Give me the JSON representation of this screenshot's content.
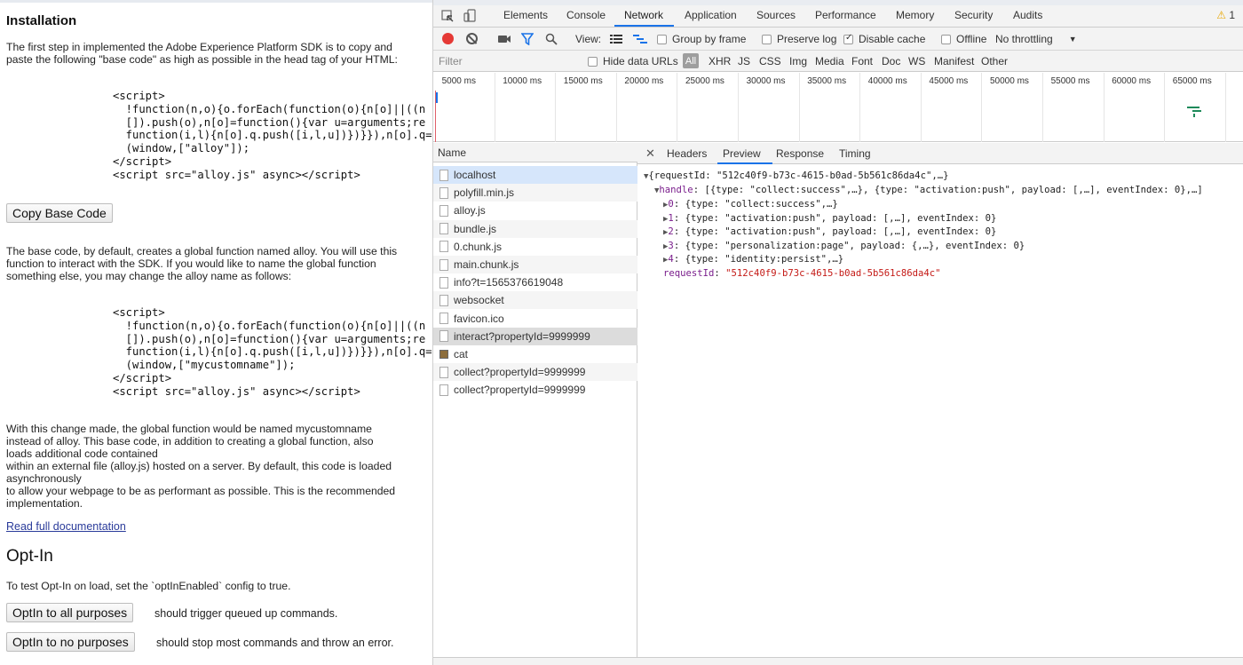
{
  "page": {
    "installation_heading": "Installation",
    "intro_lines": [
      "The first step in implemented the Adobe Experience Platform SDK is to copy and",
      "paste the following \"base code\" as high as possible in the head tag of your HTML:"
    ],
    "code_block_1": "<script>\n  !function(n,o){o.forEach(function(o){n[o]||((n\n  []).push(o),n[o]=function(){var u=arguments;re\n  function(i,l){n[o].q.push([i,l,u])})}}),n[o].q=[\n  (window,[\"alloy\"]);\n</script>\n<script src=\"alloy.js\" async></script>",
    "copy_button": "Copy Base Code",
    "rename_lines": [
      "The base code, by default, creates a global function named alloy. You will use this",
      "function to interact with the SDK. If you would like to name the global function",
      "something else, you may change the alloy name as follows:"
    ],
    "code_block_2": "<script>\n  !function(n,o){o.forEach(function(o){n[o]||((n\n  []).push(o),n[o]=function(){var u=arguments;re\n  function(i,l){n[o].q.push([i,l,u])})}}),n[o].q=[\n  (window,[\"mycustomname\"]);\n</script>\n<script src=\"alloy.js\" async></script>",
    "change_lines": [
      "With this change made, the global function would be named mycustomname",
      "instead of alloy. This base code, in addition to creating a global function, also",
      "loads additional code contained",
      "within an external file (alloy.js) hosted on a server. By default, this code is loaded",
      "asynchronously",
      "to allow your webpage to be as performant as possible. This is the recommended",
      "implementation."
    ],
    "doc_link": "Read full documentation",
    "optin_heading": "Opt-In",
    "optin_text": "To test Opt-In on load, set the `optInEnabled` config to true.",
    "optin_all_button": "OptIn to all purposes",
    "optin_all_note": "should trigger queued up commands.",
    "optin_none_button": "OptIn to no purposes",
    "optin_none_note": "should stop most commands and throw an error."
  },
  "devtools": {
    "tabs": [
      "Elements",
      "Console",
      "Network",
      "Application",
      "Sources",
      "Performance",
      "Memory",
      "Security",
      "Audits"
    ],
    "active_tab": "Network",
    "warning_count": "1",
    "toolbar": {
      "view_label": "View:",
      "group_by_frame": "Group by frame",
      "preserve_log": "Preserve log",
      "disable_cache": "Disable cache",
      "offline": "Offline",
      "throttling": "No throttling"
    },
    "filter": {
      "placeholder": "Filter",
      "hide_data_urls": "Hide data URLs",
      "all": "All",
      "types": [
        "XHR",
        "JS",
        "CSS",
        "Img",
        "Media",
        "Font",
        "Doc",
        "WS",
        "Manifest",
        "Other"
      ]
    },
    "timeline_labels": [
      "5000 ms",
      "10000 ms",
      "15000 ms",
      "20000 ms",
      "25000 ms",
      "30000 ms",
      "35000 ms",
      "40000 ms",
      "45000 ms",
      "50000 ms",
      "55000 ms",
      "60000 ms",
      "65000 ms"
    ],
    "name_header": "Name",
    "requests": [
      {
        "name": "localhost",
        "state": "selected"
      },
      {
        "name": "polyfill.min.js",
        "state": ""
      },
      {
        "name": "alloy.js",
        "state": ""
      },
      {
        "name": "bundle.js",
        "state": ""
      },
      {
        "name": "0.chunk.js",
        "state": ""
      },
      {
        "name": "main.chunk.js",
        "state": ""
      },
      {
        "name": "info?t=1565376619048",
        "state": ""
      },
      {
        "name": "websocket",
        "state": ""
      },
      {
        "name": "favicon.ico",
        "state": ""
      },
      {
        "name": "interact?propertyId=9999999",
        "state": "highlight"
      },
      {
        "name": "cat",
        "state": "image"
      },
      {
        "name": "collect?propertyId=9999999",
        "state": ""
      },
      {
        "name": "collect?propertyId=9999999",
        "state": ""
      }
    ],
    "preview_tabs": [
      "Headers",
      "Preview",
      "Response",
      "Timing"
    ],
    "active_preview_tab": "Preview",
    "preview": {
      "root": "{requestId: \"512c40f9-b73c-4615-b0ad-5b561c86da4c\",…}",
      "handle_key": "handle",
      "handle_summary": "[{type: \"collect:success\",…}, {type: \"activation:push\", payload: [,…], eventIndex: 0},…]",
      "items": [
        {
          "key": "0",
          "value": "{type: \"collect:success\",…}"
        },
        {
          "key": "1",
          "value": "{type: \"activation:push\", payload: [,…], eventIndex: 0}"
        },
        {
          "key": "2",
          "value": "{type: \"activation:push\", payload: [,…], eventIndex: 0}"
        },
        {
          "key": "3",
          "value": "{type: \"personalization:page\", payload: {,…}, eventIndex: 0}"
        },
        {
          "key": "4",
          "value": "{type: \"identity:persist\",…}"
        }
      ],
      "request_id_key": "requestId",
      "request_id_value": "\"512c40f9-b73c-4615-b0ad-5b561c86da4c\""
    }
  }
}
